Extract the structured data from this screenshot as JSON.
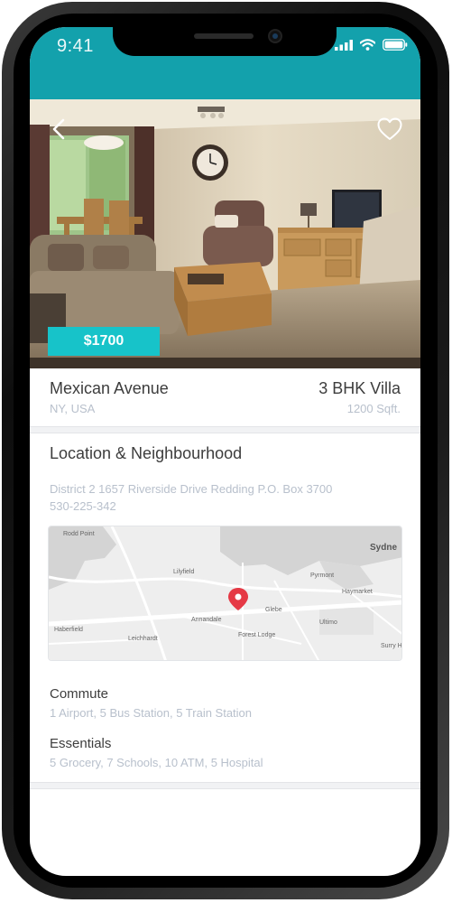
{
  "status_bar": {
    "time": "9:41",
    "color": "#13a1ac"
  },
  "listing": {
    "price": "$1700",
    "name": "Mexican Avenue",
    "location": "NY, USA",
    "type": "3 BHK Villa",
    "size": "1200 Sqft."
  },
  "location_section": {
    "title": "Location & Neighbourhood",
    "address": "District 2 1657 Riverside Drive Redding P.O. Box 3700",
    "phone": "530-225-342",
    "map_labels": [
      "Rodd Point",
      "Lilyfield",
      "Sydne",
      "Pyrmont",
      "Haymarket",
      "Glebe",
      "Annandale",
      "Ultimo",
      "Haberfield",
      "Leichhardt",
      "Forest Lodge",
      "Surry H"
    ]
  },
  "commute": {
    "label": "Commute",
    "value": "1 Airport, 5 Bus Station, 5 Train Station"
  },
  "essentials": {
    "label": "Essentials",
    "value": "5 Grocery, 7 Schools, 10 ATM, 5 Hospital"
  },
  "colors": {
    "accent": "#17c3c9",
    "pin": "#e53945",
    "muted_text": "#b8c0cc"
  },
  "icons": [
    "back-arrow-icon",
    "heart-icon",
    "signal-icon",
    "wifi-icon",
    "battery-icon",
    "map-pin-icon"
  ]
}
